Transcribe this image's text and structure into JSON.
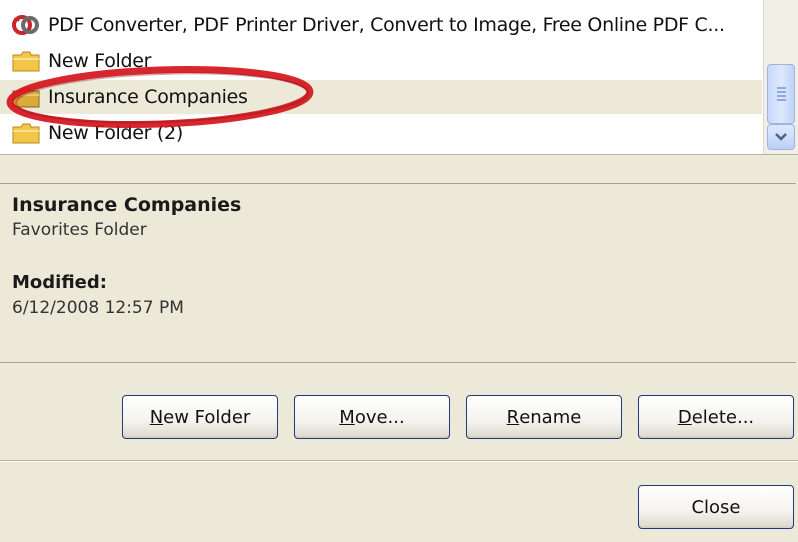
{
  "list": {
    "items": [
      {
        "label": "PDF Converter, PDF Printer Driver, Convert to Image, Free Online PDF C...",
        "icon": "pdf-converter-icon"
      },
      {
        "label": "New Folder",
        "icon": "folder-icon"
      },
      {
        "label": "Insurance Companies",
        "icon": "folder-icon",
        "selected": true
      },
      {
        "label": "New Folder (2)",
        "icon": "folder-icon"
      }
    ]
  },
  "info": {
    "name": "Insurance Companies",
    "type": "Favorites Folder",
    "modified_label": "Modified:",
    "modified_value": "6/12/2008 12:57 PM"
  },
  "buttons": {
    "new_folder": {
      "pre": "",
      "ul": "N",
      "post": "ew Folder"
    },
    "move": {
      "pre": "",
      "ul": "M",
      "post": "ove..."
    },
    "rename": {
      "pre": "",
      "ul": "R",
      "post": "ename"
    },
    "delete": {
      "pre": "",
      "ul": "D",
      "post": "elete..."
    },
    "close": "Close"
  },
  "colors": {
    "dialog_bg": "#ece9d8",
    "highlight_ring": "#d4141c",
    "folder": "#f3c64a"
  }
}
